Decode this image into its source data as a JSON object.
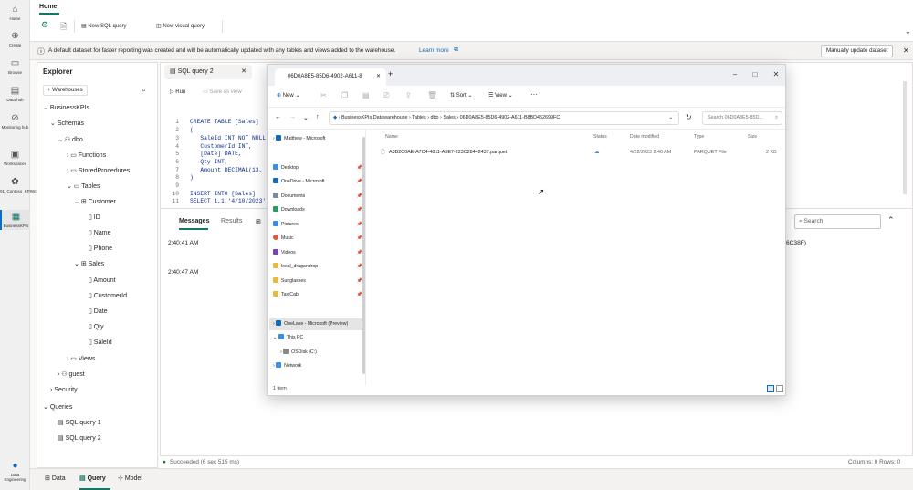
{
  "nav": {
    "items": [
      {
        "label": "Home",
        "icon": "home-icon"
      },
      {
        "label": "Create",
        "icon": "create-icon"
      },
      {
        "label": "Browse",
        "icon": "browse-icon"
      },
      {
        "label": "Data hub",
        "icon": "datahub-icon"
      },
      {
        "label": "Monitoring hub",
        "icon": "monitoring-icon"
      },
      {
        "label": "Workspaces",
        "icon": "workspaces-icon"
      },
      {
        "label": "01_Contoso_KPIWorks...",
        "icon": "workspace-icon"
      },
      {
        "label": "BusinessKPIs",
        "icon": "warehouse-icon"
      }
    ],
    "bottom_label": "Data Engineering"
  },
  "ribbon": {
    "tab": "Home",
    "new_sql": "New SQL query",
    "new_visual": "New visual query"
  },
  "banner": {
    "text": "A default dataset for faster reporting was created and will be automatically updated with any tables and views added to the warehouse.",
    "link": "Learn more",
    "button": "Manually update dataset"
  },
  "explorer": {
    "title": "Explorer",
    "warehouses_btn": "Warehouses",
    "tree": {
      "root": "BusinessKPIs",
      "schemas": "Schemas",
      "dbo": "dbo",
      "functions": "Functions",
      "storedprocs": "StoredProcedures",
      "tables": "Tables",
      "customer": "Customer",
      "customer_cols": [
        "ID",
        "Name",
        "Phone"
      ],
      "sales": "Sales",
      "sales_cols": [
        "Amount",
        "CustomerId",
        "Date",
        "Qty",
        "SaleId"
      ],
      "views": "Views",
      "guest": "guest",
      "security": "Security",
      "queries": "Queries",
      "query1": "SQL query 1",
      "query2": "SQL query 2"
    }
  },
  "editor": {
    "tab": "SQL query 2",
    "run": "Run",
    "save_as_view": "Save as view",
    "line_numbers": [
      "1",
      "2",
      "3",
      "4",
      "5",
      "6",
      "7",
      "8",
      "9",
      "10",
      "11"
    ],
    "lines": [
      "CREATE TABLE [Sales]",
      "(",
      "   SaleId INT NOT NULL",
      "   CustomerId INT,",
      "   [Date] DATE,",
      "   Qty INT,",
      "   Amount DECIMAL(13,",
      ")",
      "",
      "INSERT INTO [Sales]",
      "SELECT 1,1,'4/10/2023'"
    ],
    "results_tabs": [
      "Messages",
      "Results"
    ],
    "messages": [
      "2:40:41 AM",
      "2:40:47 AM"
    ],
    "right_snippet": "6C38F)",
    "search_placeholder": "Search",
    "status": "Succeeded (6 sec 515 ms)",
    "columns_rows": "Columns: 0  Rows: 0"
  },
  "bottom_tabs": [
    "Data",
    "Query",
    "Model"
  ],
  "explorer_window": {
    "tab_title": "06D0A8E5-85D6-4902-A611-8",
    "commands": {
      "new": "New",
      "sort": "Sort",
      "view": "View"
    },
    "breadcrumb": [
      "BusinessKPIs.Datawarehouse",
      "Tables",
      "dbo",
      "Sales",
      "06D0A8E5-85D6-4902-A611-B8BD452699FC"
    ],
    "search_placeholder": "Search 06D0A8E5-85D...",
    "nav": {
      "top": "Matthew - Microsoft",
      "quick": [
        "Desktop",
        "OneDrive - Microsoft",
        "Documents",
        "Downloads",
        "Pictures",
        "Music",
        "Videos",
        "local_dragandrop",
        "Sunglasses",
        "TaxiCab"
      ],
      "onelake": "OneLake - Microsoft (Preview)",
      "thispc": "This PC",
      "osdisk": "OSDisk (C:)",
      "network": "Network"
    },
    "columns": [
      "Name",
      "Status",
      "Date modified",
      "Type",
      "Size"
    ],
    "files": [
      {
        "name": "A3B2C0AE-A7C4-4811-A5E7-223C28442437.parquet",
        "status": "☁",
        "modified": "4/22/2023 2:40 AM",
        "type": "PARQUET File",
        "size": "2 KB"
      }
    ],
    "item_count": "1 item"
  }
}
